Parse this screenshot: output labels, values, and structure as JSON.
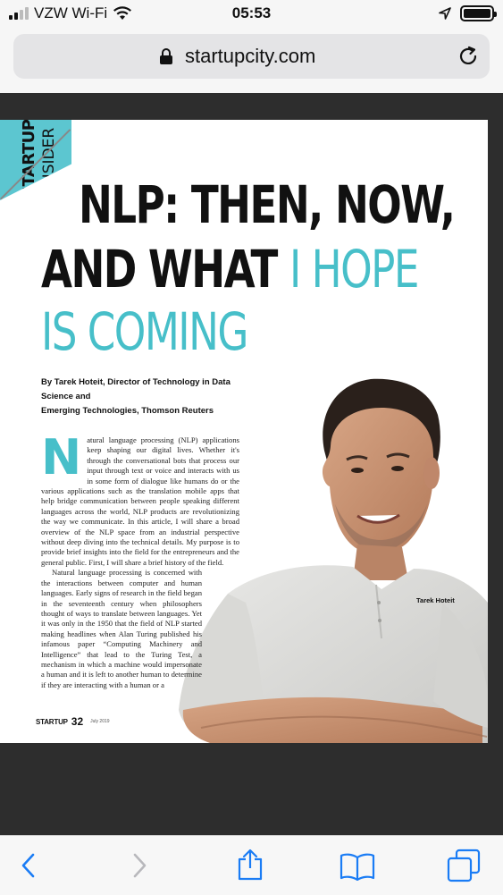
{
  "status_bar": {
    "carrier": "VZW Wi-Fi",
    "time": "05:53",
    "battery_level": 1.0
  },
  "browser": {
    "url": "startupcity.com",
    "icons": [
      "lock-icon",
      "reload-icon",
      "back-icon",
      "forward-icon",
      "share-icon",
      "bookmarks-icon",
      "tabs-icon"
    ]
  },
  "article": {
    "section_tag": "STARTUP",
    "section_tag_sub": "INSIDER",
    "headline_line1": "NLP: THEN, NOW,",
    "headline_line2_dark": "AND WHAT",
    "headline_line2_accent": "I HOPE",
    "headline_line3": "IS COMING",
    "byline_line1": "By Tarek Hoteit, Director of Technology in Data Science and",
    "byline_line2": "Emerging Technologies, Thomson Reuters",
    "dropcap": "N",
    "paragraph1": "atural language processing (NLP) applications keep shaping our digital lives. Whether it's through the conversational bots that process our input through text or voice and interacts with us in some form of dialogue like humans do or the various applications such as the translation mobile apps that help bridge communication between people speaking different languages across the world, NLP products are revolutionizing the way we communicate. In this article, I will share a broad overview of the NLP space from an industrial perspective without deep diving into the technical details. My purpose is to provide brief insights into the field for the entrepreneurs and the general public. First, I will share a brief history of the field.",
    "paragraph2": "Natural language processing is concerned with the interactions between computer and human languages. Early signs of research in the field began in the seventeenth century when philosophers thought of ways to translate between languages. Yet it was only in the 1950 that the field of NLP started making headlines when Alan Turing published his infamous paper “Computing Machinery and Intelligence” that lead to the Turing Test, a mechanism in which a machine would impersonate a human and it is left to another human to determine if they are interacting with a human or a",
    "photo_caption": "Tarek Hoteit",
    "footer_brand": "STARTUP",
    "page_number": "32",
    "footer_date": "July 2019"
  },
  "colors": {
    "accent": "#47bfc9",
    "headline": "#111111",
    "viewer_bg": "#2d2d2d",
    "ios_blue": "#1a7cf5"
  }
}
